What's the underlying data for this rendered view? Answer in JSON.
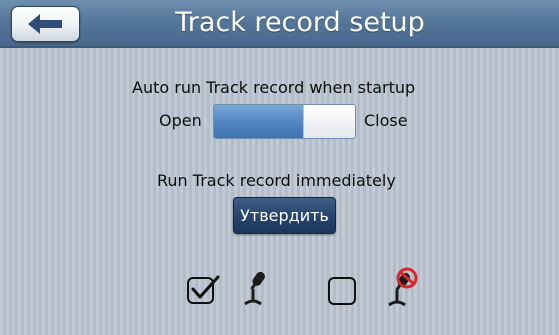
{
  "header": {
    "back_icon": "back-arrow-icon",
    "title": "Track record setup"
  },
  "autorun": {
    "label": "Auto run Track record when startup",
    "open_label": "Open",
    "close_label": "Close",
    "toggle_state": "Open"
  },
  "run_now": {
    "label": "Run Track record immediately",
    "button_label": "Утвердить"
  },
  "voice_options": [
    {
      "checkbox": "checked",
      "icon": "microphone-icon"
    },
    {
      "checkbox": "unchecked",
      "icon": "microphone-muted-icon"
    }
  ],
  "colors": {
    "header": "#55779a",
    "toggle_fill": "#4f84c2",
    "button": "#24436b",
    "mute_badge": "#d9262c"
  }
}
